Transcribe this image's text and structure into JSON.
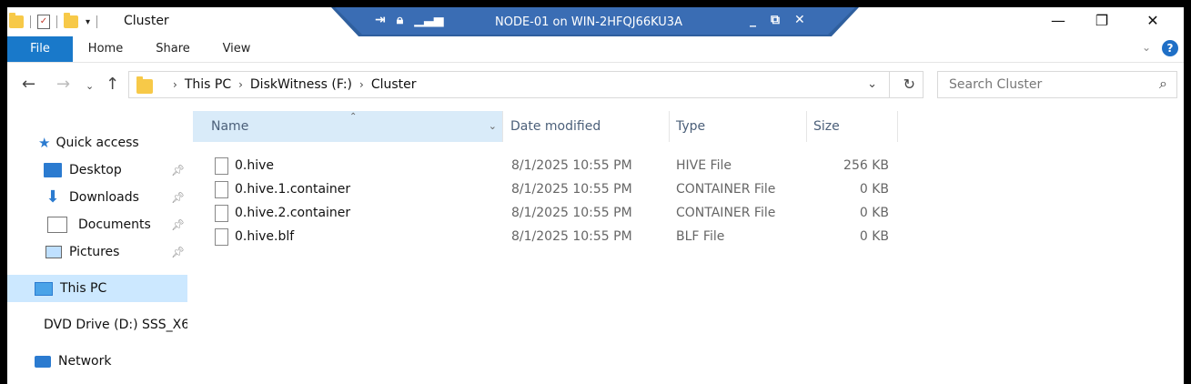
{
  "window": {
    "title": "Cluster"
  },
  "remote": {
    "title": "NODE-01 on WIN-2HFQJ66KU3A"
  },
  "ribbon": {
    "tabs": [
      "File",
      "Home",
      "Share",
      "View"
    ]
  },
  "address": {
    "crumbs": [
      "This PC",
      "DiskWitness (F:)",
      "Cluster"
    ]
  },
  "search": {
    "placeholder": "Search Cluster"
  },
  "nav": {
    "quick_access": "Quick access",
    "items": [
      "Desktop",
      "Downloads",
      "Documents",
      "Pictures"
    ],
    "this_pc": "This PC",
    "dvd": "DVD Drive (D:) SSS_X6",
    "network": "Network"
  },
  "columns": {
    "name": "Name",
    "date": "Date modified",
    "type": "Type",
    "size": "Size"
  },
  "files": [
    {
      "name": "0.hive",
      "date": "8/1/2025 10:55 PM",
      "type": "HIVE File",
      "size": "256 KB"
    },
    {
      "name": "0.hive.1.container",
      "date": "8/1/2025 10:55 PM",
      "type": "CONTAINER File",
      "size": "0 KB"
    },
    {
      "name": "0.hive.2.container",
      "date": "8/1/2025 10:55 PM",
      "type": "CONTAINER File",
      "size": "0 KB"
    },
    {
      "name": "0.hive.blf",
      "date": "8/1/2025 10:55 PM",
      "type": "BLF File",
      "size": "0 KB"
    }
  ],
  "colors": {
    "accent": "#1979ca",
    "selected": "#cce8ff",
    "header_sel": "#d9ebf9",
    "remote_bar": "#2f5f9e"
  }
}
